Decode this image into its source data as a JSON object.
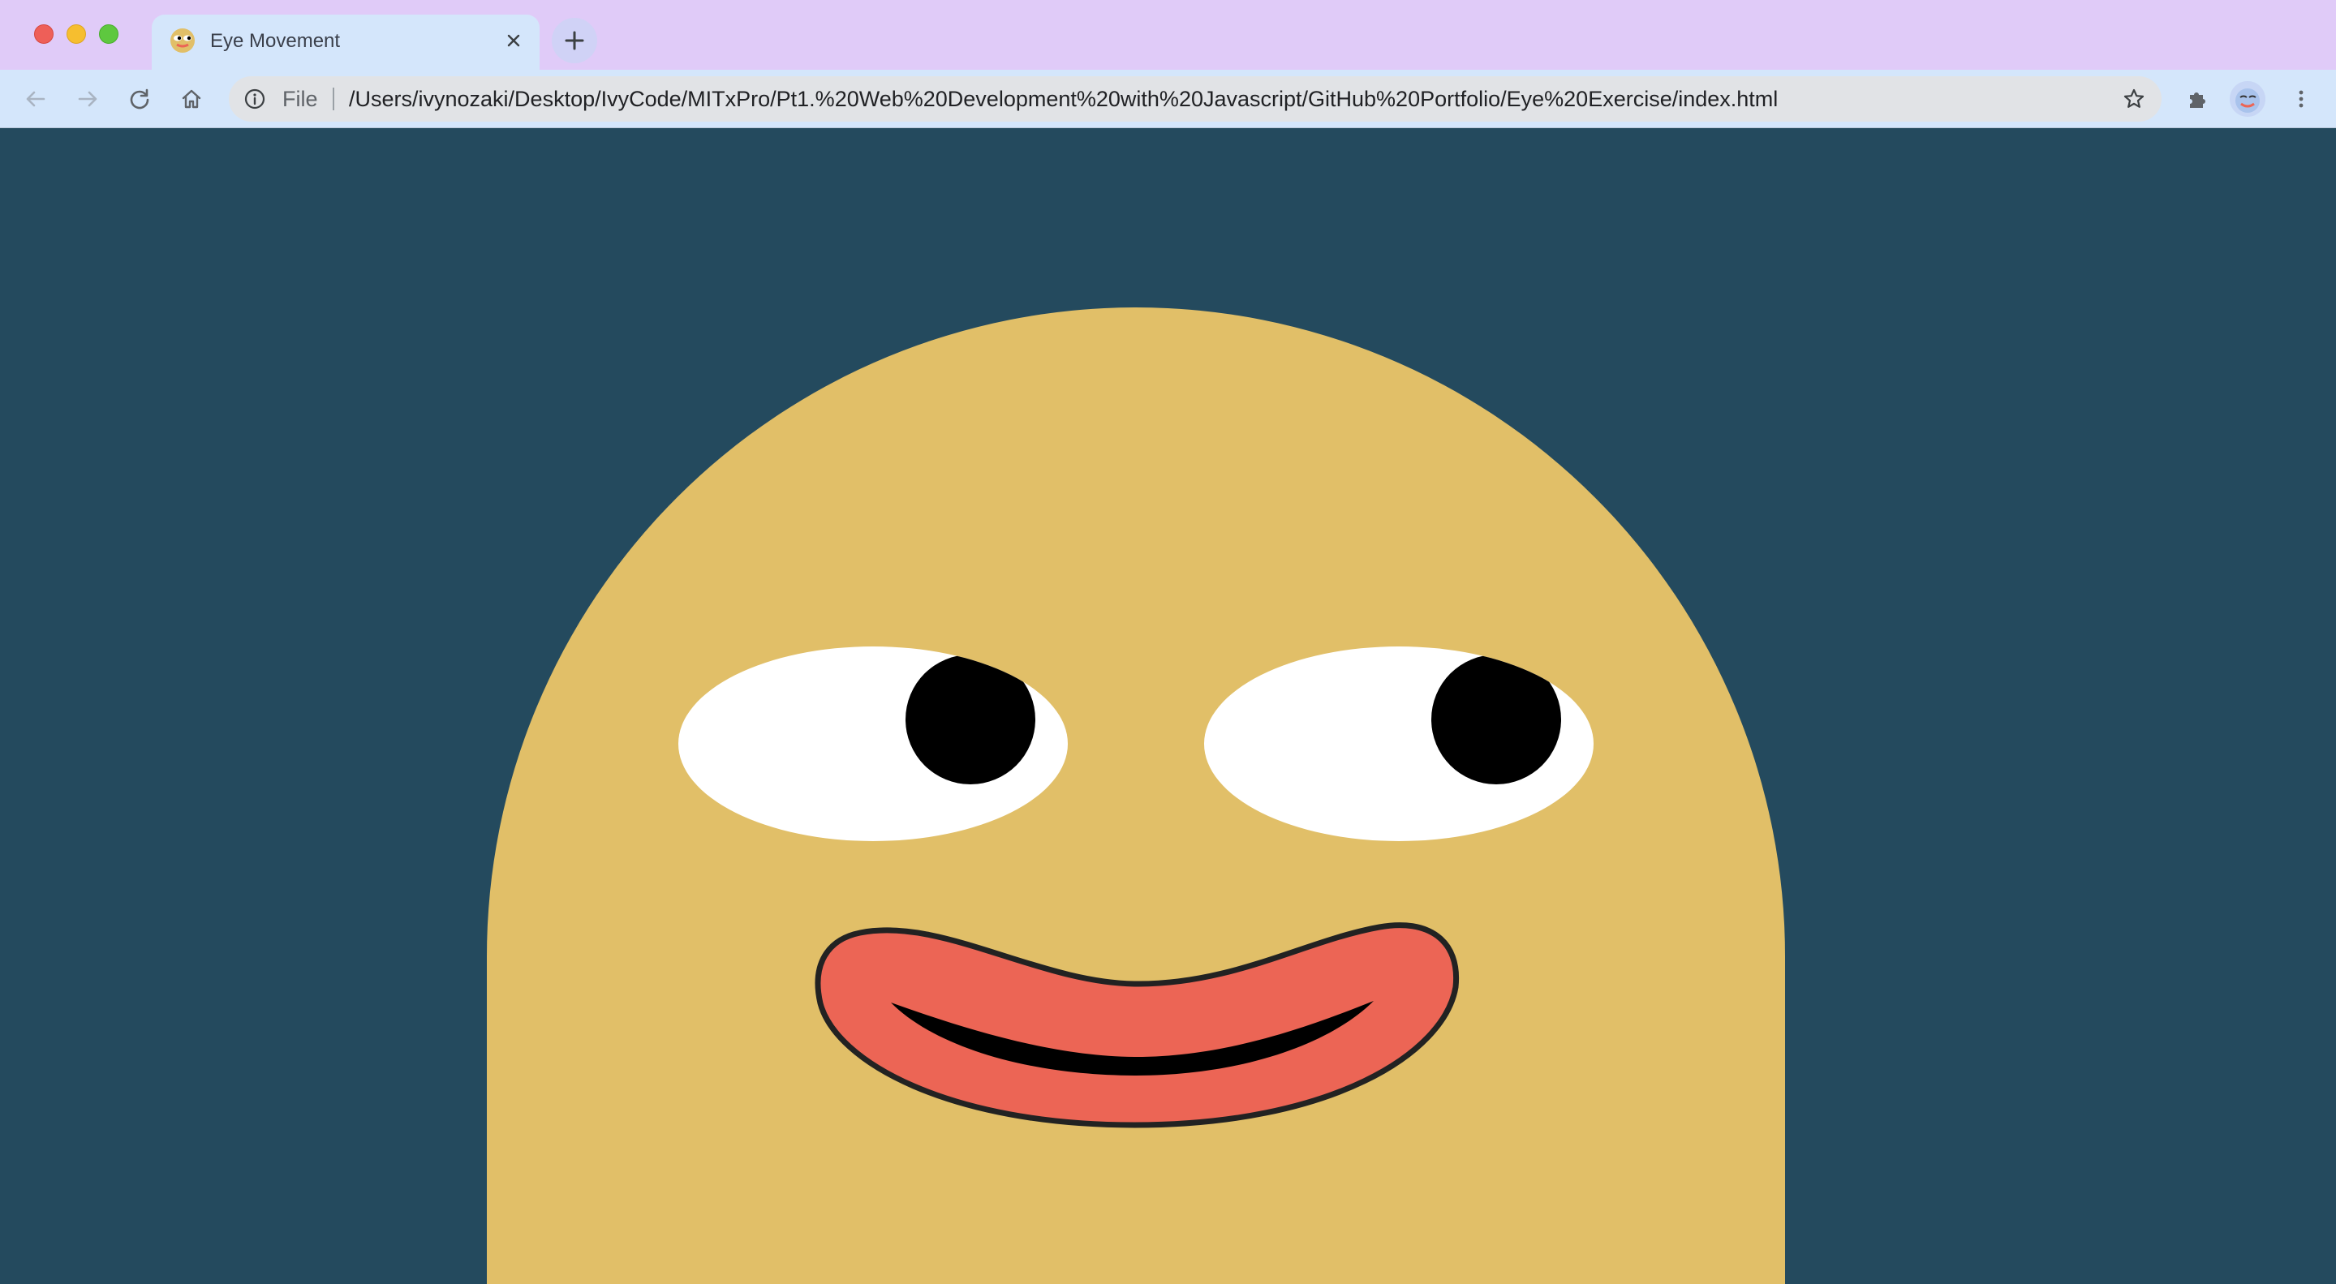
{
  "browser": {
    "tab": {
      "title": "Eye Movement",
      "favicon": "face-favicon-icon",
      "close_icon": "close-icon"
    },
    "new_tab_icon": "plus-icon",
    "toolbar": {
      "back_icon": "arrow-left-icon",
      "forward_icon": "arrow-right-icon",
      "reload_icon": "reload-icon",
      "home_icon": "home-icon",
      "omnibox": {
        "info_icon": "info-icon",
        "scheme": "File",
        "url": "/Users/ivynozaki/Desktop/IvyCode/MITxPro/Pt1.%20Web%20Development%20with%20Javascript/GitHub%20Portfolio/Eye%20Exercise/index.html",
        "bookmark_icon": "star-icon"
      },
      "extensions_icon": "puzzle-icon",
      "profile_icon": "avatar-icon",
      "menu_icon": "kebab-menu-icon"
    }
  },
  "page": {
    "background_color": "#244a5e",
    "face_color": "#e1bf68",
    "eye_white_color": "#ffffff",
    "pupil_color": "#000000",
    "lip_color": "#ec6555",
    "outline_color": "#222222"
  },
  "colors": {
    "tabstrip": "#e0cbf8",
    "toolbar": "#d4e6fb",
    "omnibox": "#e1e3e6"
  }
}
